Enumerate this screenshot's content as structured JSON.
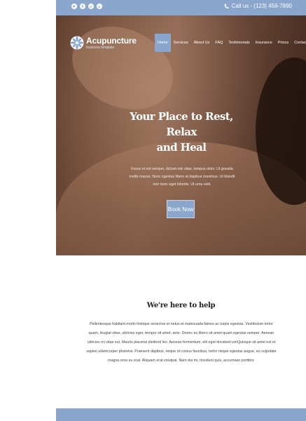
{
  "topbar": {
    "social_icons": [
      "twitter-icon",
      "facebook-icon",
      "google-plus-icon",
      "pinterest-icon"
    ],
    "phone": "Call us - (123) 456-7890"
  },
  "brand": {
    "name": "Acupuncture",
    "tagline": "business template"
  },
  "nav": {
    "items": [
      "Home",
      "Services",
      "About Us",
      "FAQ",
      "Testimonials",
      "Insurance",
      "Prices",
      "Contact"
    ],
    "active": "Home"
  },
  "hero": {
    "title_line1": "Your Place to Rest, Relax",
    "title_line2": "and Heal",
    "text": "Fusce et est semper, dictum nisi vitae, tempus dolor. Ut gravida mollis massa. Nunc egestas libero at dapibus maximus. Ut blandit non nunc eget lobortis. Ut urna velit.",
    "button": "Book Now"
  },
  "about": {
    "title": "We're here to help",
    "text": "Pellentesque habitant morbi tristique senectus et netus et malesuada fames ac turpis egestas. Vestibulum tortor quam, feugiat vitae, ultricies eget, tempor sit amet, ante. Donec eu libero sit amet quam egestas semper. Aenean ultricies mi vitae est. Mauris placerat eleifend leo. Aenean fermentum, elit eget tincidunt conQuisque sit amet est et sapien ullamcorper pharetra. Praesent dapibus, neque id cursus faucibus, tortor neque egestas augue, eu vulputate magna eros eu erat. Aliquam erat volutpat. Nam dui mi, tincidunt quis, accumsan porttitor."
  },
  "colors": {
    "accent": "#8aa6cc",
    "text_dark": "#222222",
    "text_body": "#444444"
  }
}
